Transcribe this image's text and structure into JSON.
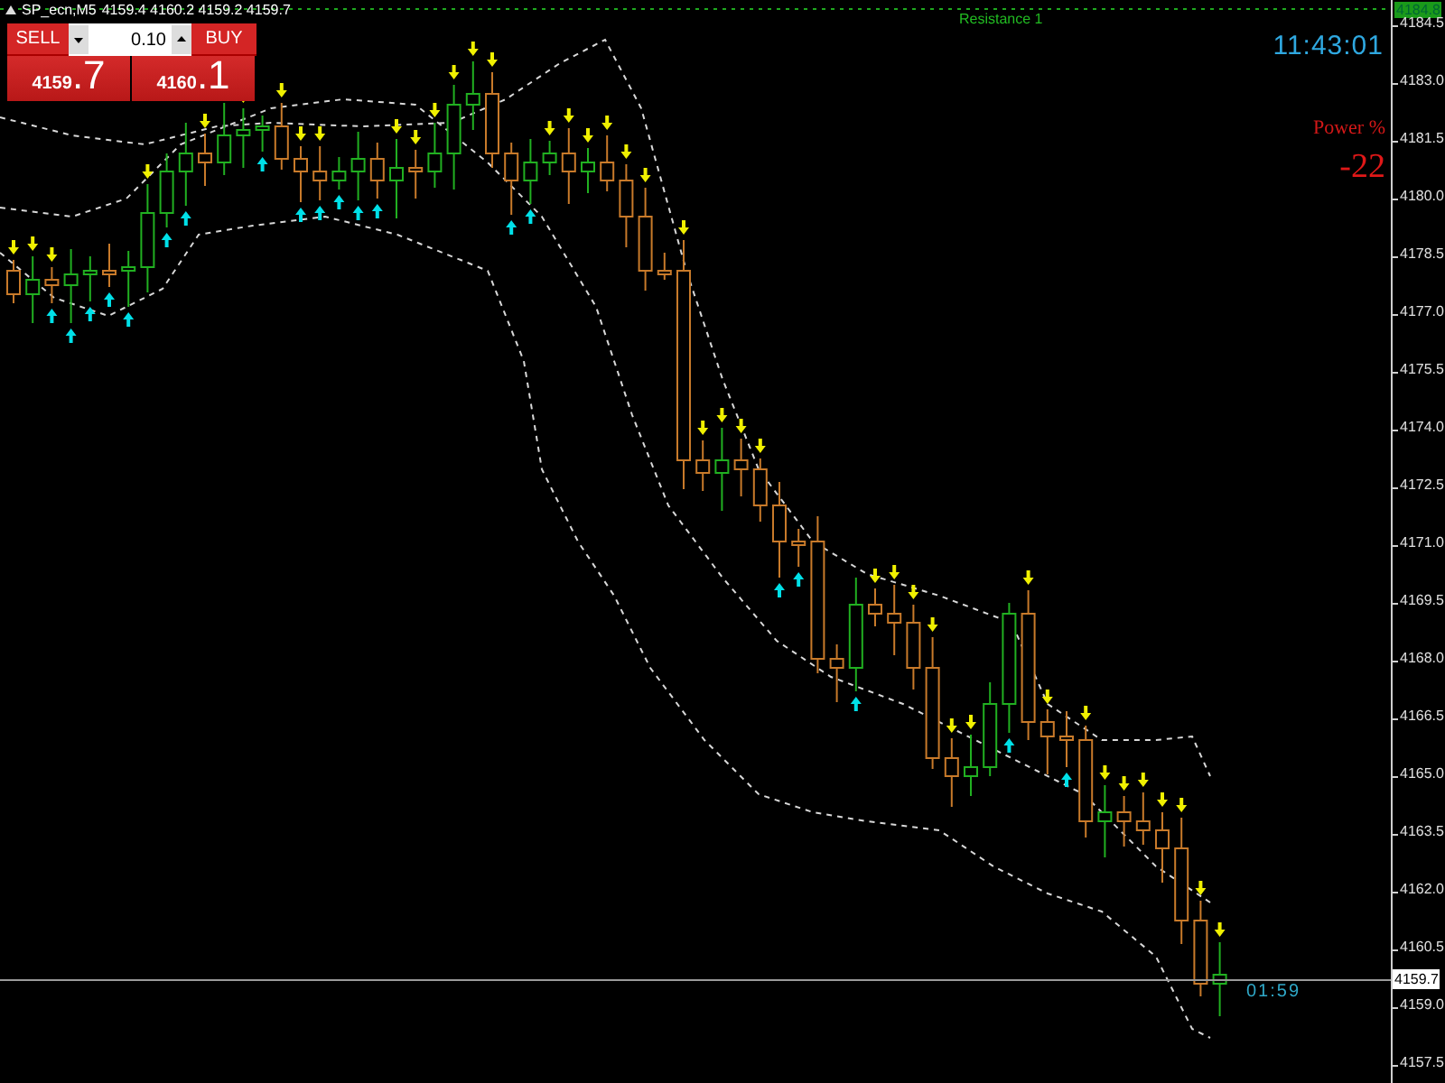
{
  "chart_header": {
    "symbol": "SP_ecn,M5",
    "prices": "4159.4 4160.2 4159.2 4159.7"
  },
  "trade_panel": {
    "sell_label": "SELL",
    "buy_label": "BUY",
    "lot_value": "0.10",
    "sell_price": {
      "main": "4159",
      "point": ".7"
    },
    "buy_price": {
      "main": "4160",
      "point": ".1"
    }
  },
  "resistance": {
    "label": "Resistance 1",
    "price_tag": "4184.8"
  },
  "clock": "11:43:01",
  "power": {
    "label": "Power %",
    "value": "-22"
  },
  "price_axis": {
    "ticks": [
      "4184.5",
      "4183.0",
      "4181.5",
      "4180.0",
      "4178.5",
      "4177.0",
      "4175.5",
      "4174.0",
      "4172.5",
      "4171.0",
      "4169.5",
      "4168.0",
      "4166.5",
      "4165.0",
      "4163.5",
      "4162.0",
      "4160.5",
      "4159.0",
      "4157.5"
    ],
    "current_price": "4159.7"
  },
  "countdown": "01:59"
}
